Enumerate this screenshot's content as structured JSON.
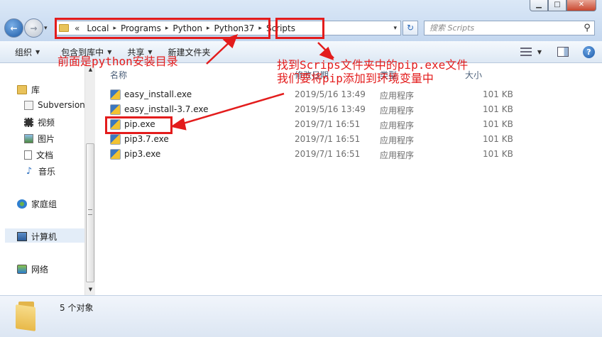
{
  "window": {
    "minimize_glyph": "▁",
    "maximize_glyph": "□",
    "close_glyph": "✕"
  },
  "navigation": {
    "back_glyph": "←",
    "forward_glyph": "→",
    "history_glyph": "▾"
  },
  "address_bar": {
    "overflow": "«",
    "separator": "▸",
    "crumbs": [
      "Local",
      "Programs",
      "Python",
      "Python37",
      "Scripts"
    ],
    "dropdown_glyph": "▾",
    "refresh_glyph": "↻"
  },
  "search": {
    "placeholder": "搜索 Scripts",
    "icon": "search-icon"
  },
  "toolbar": {
    "organize": "组织",
    "include_in_library": "包含到库中",
    "share": "共享",
    "new_folder": "新建文件夹",
    "dropdown_glyph": "▼",
    "help_glyph": "?"
  },
  "nav_pane": {
    "items": [
      {
        "label": "库",
        "icon": "library-icon"
      },
      {
        "label": "Subversion",
        "icon": "library-folder-icon"
      },
      {
        "label": "视频",
        "icon": "video-icon"
      },
      {
        "label": "图片",
        "icon": "picture-icon"
      },
      {
        "label": "文档",
        "icon": "document-icon"
      },
      {
        "label": "音乐",
        "icon": "music-icon"
      },
      {
        "label": "家庭组",
        "icon": "homegroup-icon"
      },
      {
        "label": "计算机",
        "icon": "computer-icon"
      },
      {
        "label": "网络",
        "icon": "network-icon"
      }
    ],
    "scroll_up": "▲",
    "scroll_down": "▼"
  },
  "file_list": {
    "columns": {
      "name": "名称",
      "date": "修改日期",
      "type": "类型",
      "size": "大小"
    },
    "rows": [
      {
        "name": "easy_install.exe",
        "date": "2019/5/16 13:49",
        "type": "应用程序",
        "size": "101 KB"
      },
      {
        "name": "easy_install-3.7.exe",
        "date": "2019/5/16 13:49",
        "type": "应用程序",
        "size": "101 KB"
      },
      {
        "name": "pip.exe",
        "date": "2019/7/1 16:51",
        "type": "应用程序",
        "size": "101 KB"
      },
      {
        "name": "pip3.7.exe",
        "date": "2019/7/1 16:51",
        "type": "应用程序",
        "size": "101 KB"
      },
      {
        "name": "pip3.exe",
        "date": "2019/7/1 16:51",
        "type": "应用程序",
        "size": "101 KB"
      }
    ]
  },
  "status_bar": {
    "count": "5 个对象"
  },
  "annotations": {
    "color": "#e31c1c",
    "python_dir_note": "前面是python安装目录",
    "scripts_note_line1": "找到Scrips文件夹中的pip.exe文件",
    "scripts_note_line2": "我们要将pip添加到环境变量中"
  }
}
